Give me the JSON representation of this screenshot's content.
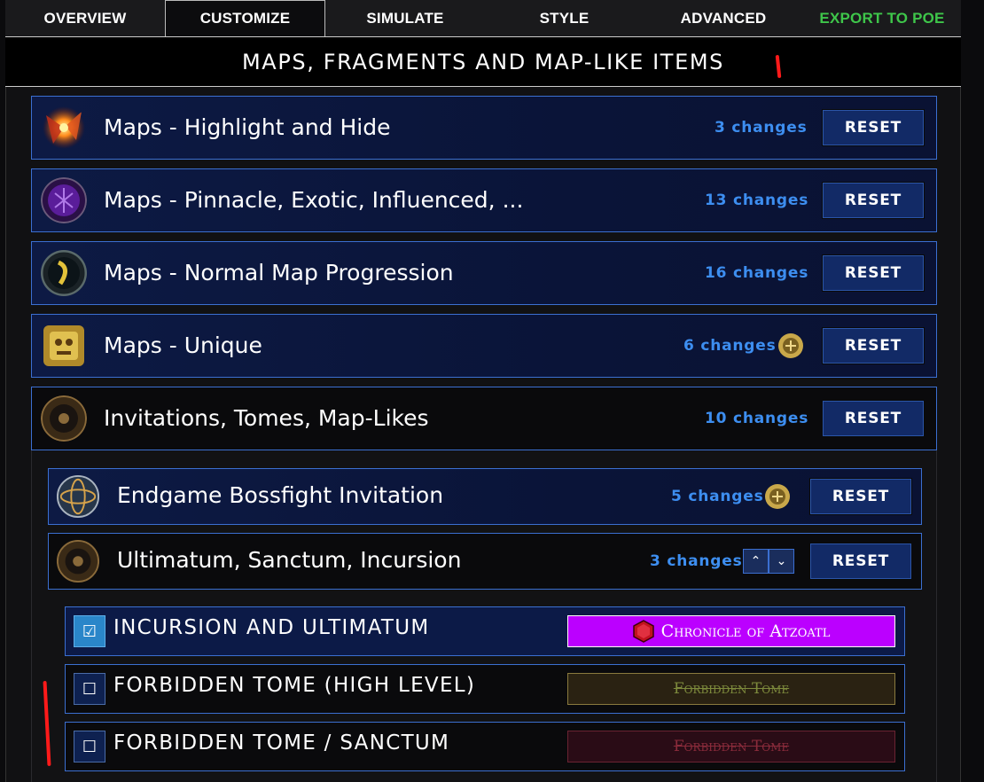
{
  "tabs": [
    {
      "label": "OVERVIEW",
      "active": false
    },
    {
      "label": "CUSTOMIZE",
      "active": true
    },
    {
      "label": "SIMULATE",
      "active": false
    },
    {
      "label": "STYLE",
      "active": false
    },
    {
      "label": "ADVANCED",
      "active": false
    },
    {
      "label": "EXPORT TO POE",
      "active": false
    }
  ],
  "section": {
    "title": "MAPS, FRAGMENTS AND MAP-LIKE ITEMS"
  },
  "groups": [
    {
      "title": "Maps - Highlight and Hide",
      "changes": "3  changes",
      "reset": "RESET",
      "icon": "map-fragment-icon"
    },
    {
      "title": "Maps - Pinnacle, Exotic, Influenced, ...",
      "changes": "13  changes",
      "reset": "RESET",
      "icon": "purple-map-icon"
    },
    {
      "title": "Maps - Normal Map Progression",
      "changes": "16  changes",
      "reset": "RESET",
      "icon": "normal-map-icon"
    },
    {
      "title": "Maps - Unique",
      "changes": "6  changes",
      "reset": "RESET",
      "icon": "unique-map-icon",
      "badge": "gold-badge-icon"
    },
    {
      "title": "Invitations, Tomes, Map-Likes",
      "changes": "10  changes",
      "reset": "RESET",
      "icon": "invitation-icon"
    }
  ],
  "subgroups": [
    {
      "title": "Endgame Bossfight Invitation",
      "changes": "5  changes",
      "reset": "RESET",
      "icon": "bossfight-orb-icon",
      "badge": "gold-badge-icon"
    },
    {
      "title": "Ultimatum, Sanctum, Incursion",
      "changes": "3  changes",
      "reset": "RESET",
      "icon": "ultimatum-icon"
    }
  ],
  "arrows": {
    "up": "⌃",
    "down": "⌄"
  },
  "rules": [
    {
      "label": "INCURSION AND ULTIMATUM",
      "checked": true,
      "check_glyph": "☑",
      "preview": "Chronicle of Atzoatl"
    },
    {
      "label": "FORBIDDEN TOME (HIGH LEVEL)",
      "checked": false,
      "check_glyph": "☐",
      "preview": "Forbidden Tome"
    },
    {
      "label": "FORBIDDEN TOME / SANCTUM",
      "checked": false,
      "check_glyph": "☐",
      "preview": "Forbidden Tome"
    }
  ],
  "colors": {
    "accent_blue": "#3b6fd1",
    "changes_text": "#3d8ef0",
    "reset_bg": "#122a66",
    "export_green": "#3ec64a",
    "atzoatl_bg": "#bb00ff",
    "annotation_red": "#ff1a1a"
  }
}
